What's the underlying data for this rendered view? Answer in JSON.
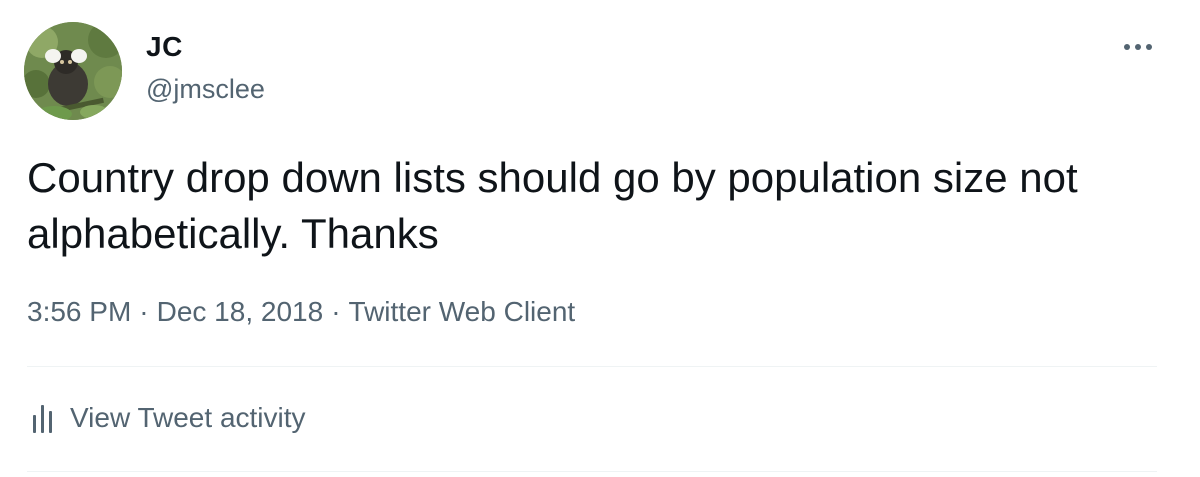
{
  "author": {
    "display_name": "JC",
    "handle": "@jmsclee",
    "avatar_icon": "marmoset-avatar-icon"
  },
  "tweet": {
    "text": "Country drop down lists should go by population size not alphabetically. Thanks",
    "time": "3:56 PM",
    "date": "Dec 18, 2018",
    "source": "Twitter Web Client",
    "separator": "·"
  },
  "actions": {
    "more_icon": "more-horizontal-icon",
    "activity_label": "View Tweet activity",
    "activity_icon": "bar-chart-icon"
  },
  "colors": {
    "text_primary": "#0f1419",
    "text_secondary": "#536471",
    "divider": "#eff3f4"
  }
}
